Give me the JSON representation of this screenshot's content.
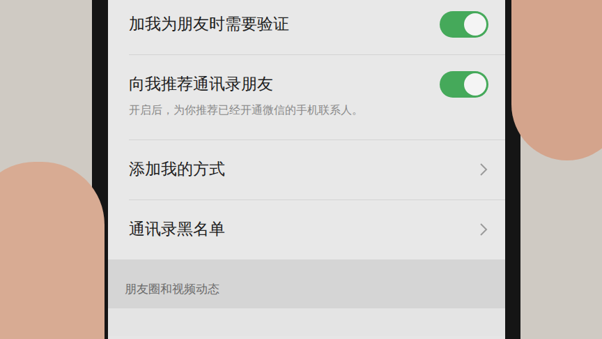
{
  "rows": [
    {
      "kind": "toggle",
      "label": "加我为朋友时需要验证",
      "on": true
    },
    {
      "kind": "toggle",
      "label": "向我推荐通讯录朋友",
      "on": true,
      "hint": "开启后，为你推荐已经开通微信的手机联系人。"
    },
    {
      "kind": "link",
      "label": "添加我的方式"
    },
    {
      "kind": "link",
      "label": "通讯录黑名单"
    }
  ],
  "section": {
    "title": "朋友圈和视频动态"
  }
}
